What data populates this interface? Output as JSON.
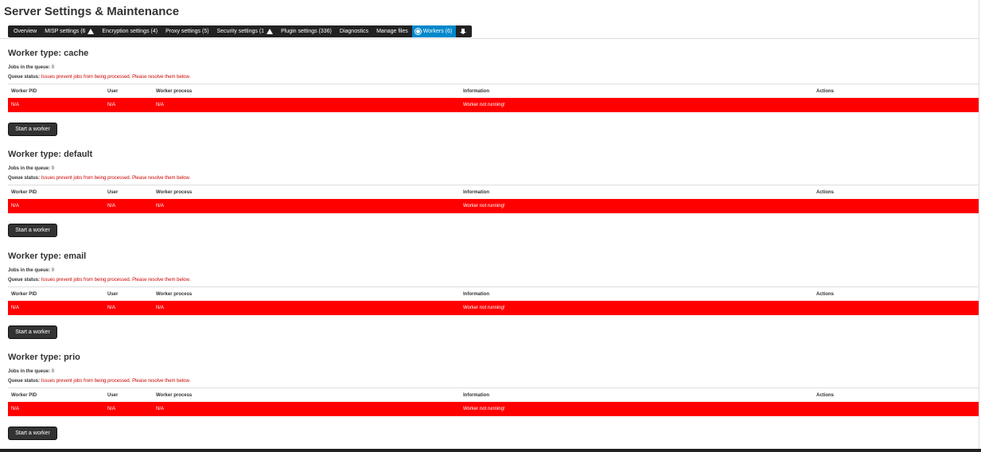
{
  "page": {
    "title": "Server Settings & Maintenance"
  },
  "tabs": [
    {
      "label": "Overview",
      "warning": false,
      "active": false
    },
    {
      "label": "MISP settings (6",
      "warning": true,
      "active": false
    },
    {
      "label": "Encryption settings (4)",
      "warning": false,
      "active": false
    },
    {
      "label": "Proxy settings (5)",
      "warning": false,
      "active": false
    },
    {
      "label": "Security settings (1",
      "warning": true,
      "active": false
    },
    {
      "label": "Plugin settings (336)",
      "warning": false,
      "active": false
    },
    {
      "label": "Diagnostics",
      "warning": false,
      "active": false
    },
    {
      "label": "Manage files",
      "warning": false,
      "active": false
    },
    {
      "label": "Workers (6)",
      "warning": false,
      "active": true,
      "icon": "gear-icon"
    },
    {
      "label": "",
      "warning": false,
      "active": false,
      "icon": "download-icon"
    }
  ],
  "labels": {
    "jobs_in_queue": "Jobs in the queue:",
    "queue_status": "Queue status:",
    "start_button": "Start a worker"
  },
  "table_headers": [
    "Worker PID",
    "User",
    "Worker process",
    "Information",
    "Actions"
  ],
  "workers": [
    {
      "title": "Worker type: cache",
      "jobs": "0",
      "status": "Issues prevent jobs from being processed. Please resolve them below.",
      "row": {
        "pid": "N/A",
        "user": "N/A",
        "process": "N/A",
        "information": "Worker not running!",
        "actions": ""
      }
    },
    {
      "title": "Worker type: default",
      "jobs": "0",
      "status": "Issues prevent jobs from being processed. Please resolve them below.",
      "row": {
        "pid": "N/A",
        "user": "N/A",
        "process": "N/A",
        "information": "Worker not running!",
        "actions": ""
      }
    },
    {
      "title": "Worker type: email",
      "jobs": "0",
      "status": "Issues prevent jobs from being processed. Please resolve them below.",
      "row": {
        "pid": "N/A",
        "user": "N/A",
        "process": "N/A",
        "information": "Worker not running!",
        "actions": ""
      }
    },
    {
      "title": "Worker type: prio",
      "jobs": "0",
      "status": "Issues prevent jobs from being processed. Please resolve them below.",
      "row": {
        "pid": "N/A",
        "user": "N/A",
        "process": "N/A",
        "information": "Worker not running!",
        "actions": ""
      }
    }
  ],
  "colors": {
    "tab_active": "#0088cc",
    "error_row": "#ff0000",
    "error_text": "#cc0000"
  }
}
